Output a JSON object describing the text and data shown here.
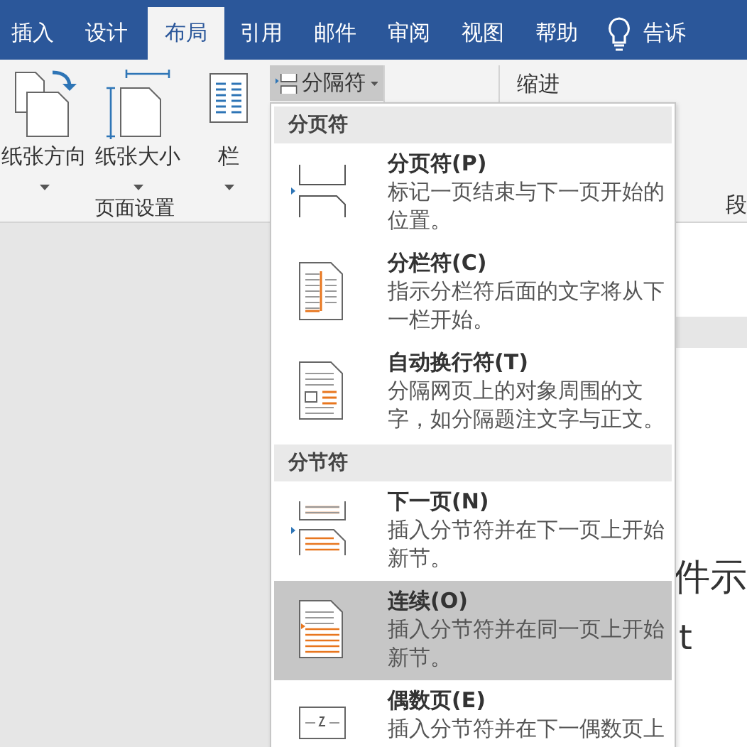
{
  "tabs": [
    {
      "label": "插入",
      "selected": false
    },
    {
      "label": "设计",
      "selected": false
    },
    {
      "label": "布局",
      "selected": true
    },
    {
      "label": "引用",
      "selected": false
    },
    {
      "label": "邮件",
      "selected": false
    },
    {
      "label": "审阅",
      "selected": false
    },
    {
      "label": "视图",
      "selected": false
    },
    {
      "label": "帮助",
      "selected": false
    }
  ],
  "tell_me": {
    "label": "告诉"
  },
  "ribbon": {
    "page_setup": {
      "label": "页面设置",
      "buttons": [
        {
          "kind": "orientation",
          "label": "纸张方向"
        },
        {
          "kind": "size",
          "label": "纸张大小"
        },
        {
          "kind": "columns",
          "label": "栏"
        }
      ]
    },
    "breaks_button": {
      "label": "分隔符"
    },
    "indent_label": "缩进",
    "paragraph_label": "段"
  },
  "menu": {
    "sections": [
      {
        "header": "分页符",
        "items": [
          {
            "kind": "page",
            "title": "分页符(P)",
            "description": "标记一页结束与下一页开始的位置。",
            "selected": false
          },
          {
            "kind": "column",
            "title": "分栏符(C)",
            "description": "指示分栏符后面的文字将从下一栏开始。",
            "selected": false
          },
          {
            "kind": "wrap",
            "title": "自动换行符(T)",
            "description": "分隔网页上的对象周围的文字，如分隔题注文字与正文。",
            "selected": false
          }
        ]
      },
      {
        "header": "分节符",
        "items": [
          {
            "kind": "next",
            "title": "下一页(N)",
            "description": "插入分节符并在下一页上开始新节。",
            "selected": false
          },
          {
            "kind": "continuous",
            "title": "连续(O)",
            "description": "插入分节符并在同一页上开始新节。",
            "selected": true
          },
          {
            "kind": "even",
            "title": "偶数页(E)",
            "description": "插入分节符并在下一偶数页上",
            "selected": false
          }
        ]
      }
    ]
  },
  "document": {
    "lines": [
      "件示",
      "t"
    ]
  }
}
